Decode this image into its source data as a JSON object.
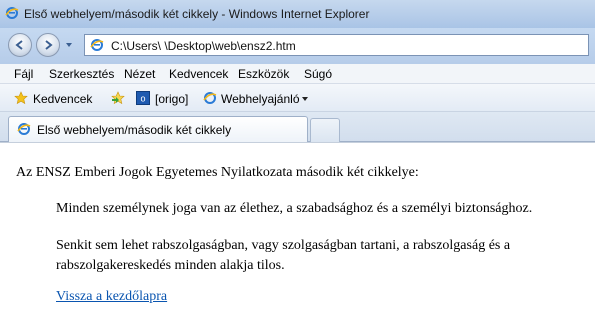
{
  "window": {
    "title": "Első webhelyem/második két cikkely - Windows Internet Explorer"
  },
  "address": {
    "url": "C:\\Users\\        \\Desktop\\web\\ensz2.htm"
  },
  "menu": {
    "items": [
      "Fájl",
      "Szerkesztés",
      "Nézet",
      "Kedvencek",
      "Eszközök",
      "Súgó"
    ]
  },
  "favorites": {
    "label": "Kedvencek",
    "origo": "[origo]",
    "suggested": "Webhelyajánló"
  },
  "tab": {
    "label": "Első webhelyem/második két cikkely"
  },
  "page": {
    "intro": "Az ENSZ Emberi Jogok Egyetemes Nyilatkozata második két cikkelye:",
    "article1": "Minden személynek joga van az élethez, a szabadsághoz és a személyi biztonsághoz.",
    "article2": "Senkit sem lehet rabszolgaságban, vagy szolgaságban tartani, a rabszolgaság és a rabszolgakereskedés minden alakja tilos.",
    "back_link": "Vissza a kezdőlapra"
  },
  "colors": {
    "link": "#0a55b0",
    "titlebar": "#b9cfea"
  }
}
